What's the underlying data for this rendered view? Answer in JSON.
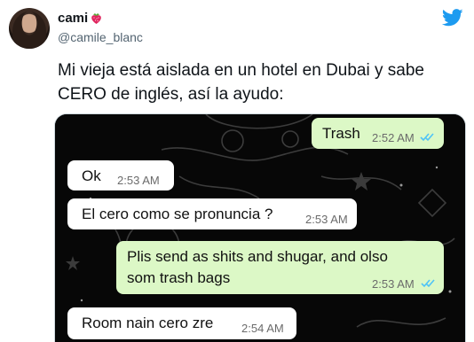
{
  "tweet": {
    "display_name": "cami",
    "username": "@camile_blanc",
    "text_line1": "Mi vieja está aislada en un hotel en Dubai y sabe",
    "text_line2": "CERO de inglés, así la ayudo:"
  },
  "chat": {
    "messages": [
      {
        "direction": "out",
        "text": "Trash",
        "time": "2:52 AM",
        "status": "read"
      },
      {
        "direction": "in",
        "text": "Ok",
        "time": "2:53 AM"
      },
      {
        "direction": "in",
        "text": "El cero como se pronuncia ?",
        "time": "2:53 AM"
      },
      {
        "direction": "out",
        "text_line1": "Plis send as shits and shugar, and olso",
        "text_line2": "som trash bags",
        "time": "2:53 AM",
        "status": "read"
      },
      {
        "direction": "in",
        "text": "Room nain cero zre",
        "time": "2:54 AM"
      }
    ]
  },
  "colors": {
    "twitter_blue": "#1d9bf0",
    "outgoing_bubble": "#dcf8c6",
    "read_ticks": "#4fc3f7"
  },
  "icons": {
    "brand": "twitter-bird-icon",
    "emoji": "strawberry-icon"
  }
}
